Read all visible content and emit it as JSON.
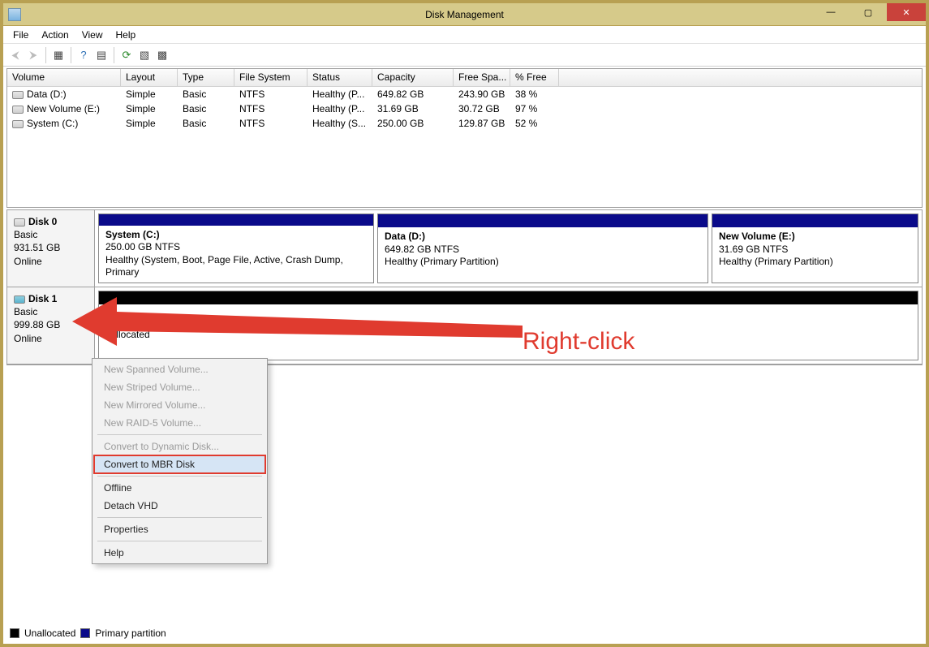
{
  "window": {
    "title": "Disk Management"
  },
  "win_controls": {
    "min": "—",
    "max": "▢",
    "close": "✕"
  },
  "menu": {
    "file": "File",
    "action": "Action",
    "view": "View",
    "help": "Help"
  },
  "columns": {
    "volume": "Volume",
    "layout": "Layout",
    "type": "Type",
    "fs": "File System",
    "status": "Status",
    "capacity": "Capacity",
    "free": "Free Spa...",
    "pct": "% Free"
  },
  "volumes": [
    {
      "name": "Data (D:)",
      "layout": "Simple",
      "type": "Basic",
      "fs": "NTFS",
      "status": "Healthy (P...",
      "cap": "649.82 GB",
      "free": "243.90 GB",
      "pct": "38 %"
    },
    {
      "name": "New Volume (E:)",
      "layout": "Simple",
      "type": "Basic",
      "fs": "NTFS",
      "status": "Healthy (P...",
      "cap": "31.69 GB",
      "free": "30.72 GB",
      "pct": "97 %"
    },
    {
      "name": "System (C:)",
      "layout": "Simple",
      "type": "Basic",
      "fs": "NTFS",
      "status": "Healthy (S...",
      "cap": "250.00 GB",
      "free": "129.87 GB",
      "pct": "52 %"
    }
  ],
  "disk0": {
    "label": "Disk 0",
    "type": "Basic",
    "size": "931.51 GB",
    "state": "Online",
    "p1": {
      "title": "System  (C:)",
      "line2": "250.00 GB NTFS",
      "line3": "Healthy (System, Boot, Page File, Active, Crash Dump, Primary"
    },
    "p2": {
      "title": "Data  (D:)",
      "line2": "649.82 GB NTFS",
      "line3": "Healthy (Primary Partition)"
    },
    "p3": {
      "title": "New Volume  (E:)",
      "line2": "31.69 GB NTFS",
      "line3": "Healthy (Primary Partition)"
    }
  },
  "disk1": {
    "label": "Disk 1",
    "type": "Basic",
    "size": "999.88 GB",
    "state": "Online",
    "p1": {
      "line3": "nallocated"
    }
  },
  "legend": {
    "unalloc": "Unallocated",
    "primary": "Primary partition"
  },
  "ctx": {
    "spanned": "New Spanned Volume...",
    "striped": "New Striped Volume...",
    "mirrored": "New Mirrored Volume...",
    "raid5": "New RAID-5 Volume...",
    "dynamic": "Convert to Dynamic Disk...",
    "mbr": "Convert to MBR Disk",
    "offline": "Offline",
    "detach": "Detach VHD",
    "props": "Properties",
    "help": "Help"
  },
  "annotation": {
    "label": "Right-click"
  }
}
